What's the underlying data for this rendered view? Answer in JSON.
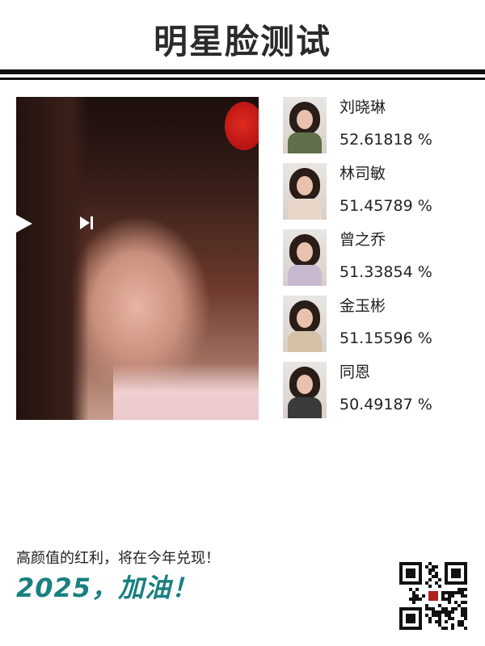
{
  "header": {
    "title": "明星脸测试"
  },
  "photo": {
    "controls": [
      "play-icon",
      "next-track-icon"
    ],
    "accent_color": "#e02a1f"
  },
  "candidates": [
    {
      "name": "刘晓琳",
      "score": "52.61818 %",
      "shirt_color": "#5f6f4a"
    },
    {
      "name": "林司敏",
      "score": "51.45789 %",
      "shirt_color": "#e8d7c9"
    },
    {
      "name": "曾之乔",
      "score": "51.33854 %",
      "shirt_color": "#c7b8cf"
    },
    {
      "name": "金玉彬",
      "score": "51.15596 %",
      "shirt_color": "#d5c1a6"
    },
    {
      "name": "同恩",
      "score": "50.49187 %",
      "shirt_color": "#3a3a3a"
    }
  ],
  "footer": {
    "line1": "高颜值的红利，将在今年兑现！",
    "line2": "2025，加油！",
    "line2_color": "#1a8080"
  },
  "qr": {
    "icon": "qr-code-icon"
  }
}
